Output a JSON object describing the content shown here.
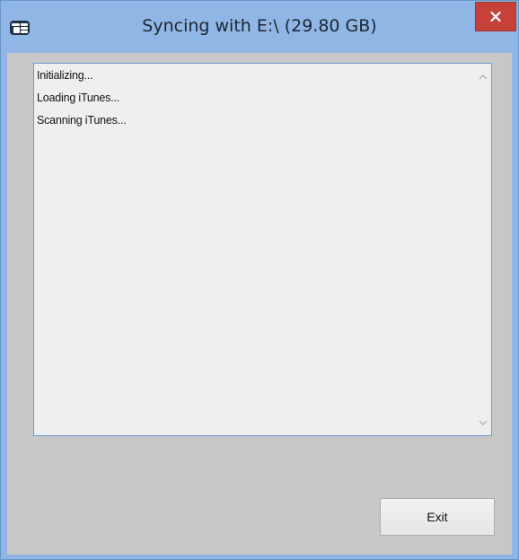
{
  "window": {
    "title": "Syncing with E:\\ (29.80 GB)",
    "app_icon": "app-logo-icon",
    "close_icon": "close-icon",
    "colors": {
      "frame": "#8fb6e4",
      "close_button": "#c7413b",
      "client_background": "#c8c8c8",
      "log_background": "#efefef",
      "log_border": "#6b9bd2"
    }
  },
  "log": {
    "lines": [
      "Initializing...",
      "Loading iTunes...",
      "Scanning iTunes..."
    ],
    "scroll_up_icon": "chevron-up-icon",
    "scroll_down_icon": "chevron-down-icon"
  },
  "footer": {
    "exit_label": "Exit"
  }
}
